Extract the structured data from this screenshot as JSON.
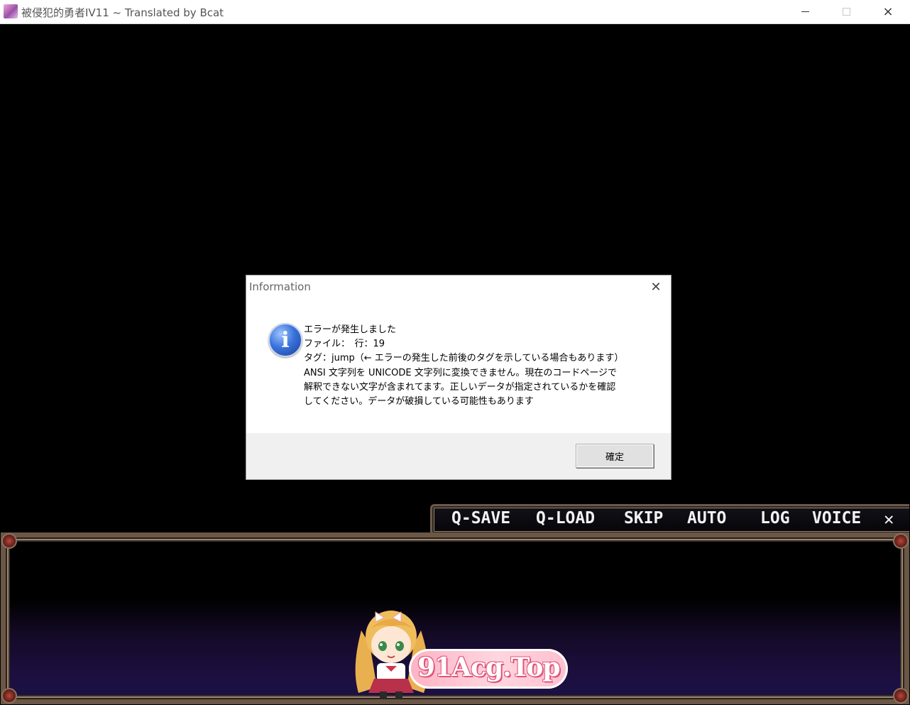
{
  "window": {
    "title": "被侵犯的勇者IV11 ~ Translated by Bcat",
    "icon": "app-icon",
    "controls": {
      "minimize": "minimize-icon",
      "maximize": "maximize-icon",
      "close": "×"
    }
  },
  "quick_menu": {
    "save": "Q-SAVE",
    "load": "Q-LOAD",
    "skip": "SKIP",
    "auto": "AUTO",
    "log": "LOG",
    "voice": "VOICE",
    "close": "✕"
  },
  "watermark": {
    "text": "91Acg.Top"
  },
  "dialog": {
    "title": "Information",
    "close": "✕",
    "icon": "info-icon",
    "icon_glyph": "i",
    "lines": [
      "エラーが発生しました",
      "ファイル：　行：19",
      "タグ：jump（← エラーの発生した前後のタグを示している場合もあります）",
      "ANSI 文字列を UNICODE 文字列に変換できません。現在のコードページで",
      "解釈できない文字が含まれてます。正しいデータが指定されているかを確認",
      "してください。データが破損している可能性もあります"
    ],
    "ok_label": "確定"
  },
  "colors": {
    "frame": "#6b5746",
    "frame_light": "#9d8572",
    "info_blue": "#3a74dc",
    "watermark_pink": "#ffb2c4"
  }
}
